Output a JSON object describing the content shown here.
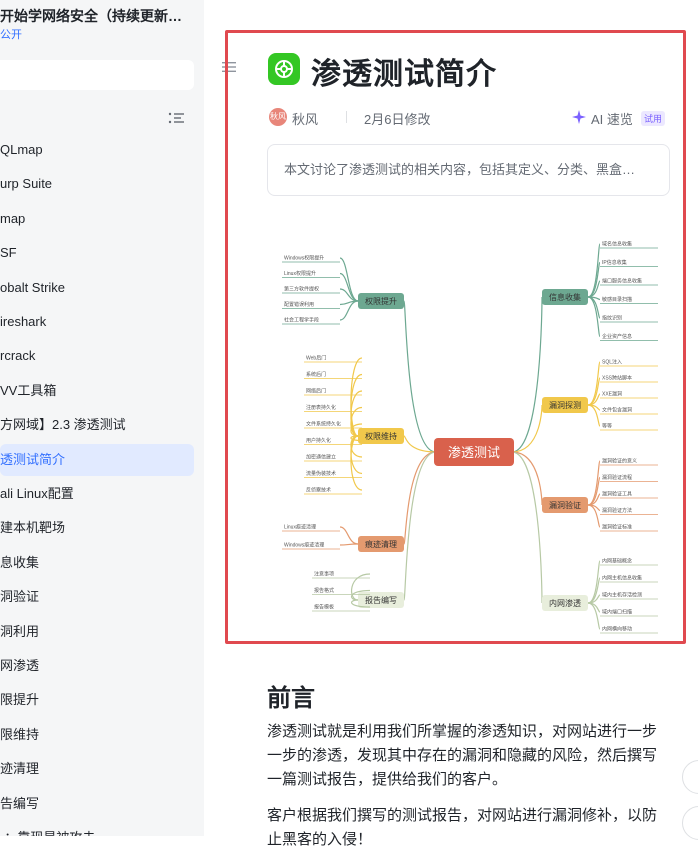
{
  "sidebar": {
    "kb_title": "开始学网络安全（持续更新…",
    "kb_visibility": "公开",
    "items": [
      {
        "label": "QLmap"
      },
      {
        "label": "urp Suite"
      },
      {
        "label": "map"
      },
      {
        "label": "SF"
      },
      {
        "label": "obalt Strike"
      },
      {
        "label": "ireshark"
      },
      {
        "label": "rcrack"
      },
      {
        "label": "VV工具箱"
      },
      {
        "label": "方网域】2.3 渗透测试"
      },
      {
        "label": "透测试简介"
      },
      {
        "label": "ali Linux配置"
      },
      {
        "label": "建本机靶场"
      },
      {
        "label": "息收集"
      },
      {
        "label": "洞验证"
      },
      {
        "label": "洞利用"
      },
      {
        "label": "网渗透"
      },
      {
        "label": "限提升"
      },
      {
        "label": "限维持"
      },
      {
        "label": "迹清理"
      },
      {
        "label": "告编写"
      },
      {
        "label": "·：靠现是被攻击"
      }
    ],
    "active_index": 9
  },
  "doc": {
    "title": "渗透测试简介",
    "author_avatar": "秋风",
    "author": "秋风",
    "modified": "2月6日修改",
    "ai_label": "AI 速览",
    "ai_badge": "试用",
    "summary": "本文讨论了渗透测试的相关内容，包括其定义、分类、黑盒…",
    "heading": "前言",
    "para1": "渗透测试就是利用我们所掌握的渗透知识，对网站进行一步一步的渗透，发现其中存在的漏洞和隐藏的风险，然后撰写一篇测试报告，提供给我们的客户。",
    "para2": "客户根据我们撰写的测试报告，对网站进行漏洞修补，以防止黑客的入侵！"
  },
  "mindmap": {
    "center": "渗透测试",
    "colors": {
      "center": "#d9614c",
      "green": "#6da891",
      "yellow": "#f1c84b",
      "orange": "#e49a6f",
      "pale": "#e8eedc"
    },
    "branches": {
      "privesc": {
        "label": "权限提升",
        "leaves": [
          "Windows权限提升",
          "Linux权限提升",
          "第三方软件提权",
          "配置错误利用",
          "社会工程学手段"
        ]
      },
      "persist": {
        "label": "权限维持",
        "leaves": [
          "Web后门",
          "系统后门",
          "网络后门",
          "注册表持久化",
          "文件系统持久化",
          "用户持久化",
          "加密通信建立",
          "流量伪装技术",
          "反侦察技术"
        ]
      },
      "cleanup": {
        "label": "痕迹清理",
        "leaves": [
          "Linux痕迹清理",
          "Windows痕迹清理"
        ]
      },
      "report": {
        "label": "报告编写",
        "leaves": [
          "注意事项",
          "报告格式",
          "报告模板"
        ]
      },
      "info": {
        "label": "信息收集",
        "leaves": [
          "域名信息收集",
          "IP信息收集",
          "端口服务信息收集",
          "敏感目录扫描",
          "指纹识别",
          "企业资产信息"
        ]
      },
      "vuln": {
        "label": "漏洞探测",
        "leaves": [
          "SQL注入",
          "XSS跨站脚本",
          "XXE漏洞",
          "文件包含漏洞",
          "等等"
        ]
      },
      "verify": {
        "label": "漏洞验证",
        "leaves": [
          "漏洞验证的意义",
          "漏洞验证流程",
          "漏洞验证工具",
          "漏洞验证方法",
          "漏洞验证标准"
        ]
      },
      "lateral": {
        "label": "内网渗透",
        "leaves": [
          "内网基础概念",
          "内网主机信息收集",
          "域内主机存活检测",
          "域内端口扫描",
          "内网横向移动"
        ]
      }
    }
  }
}
